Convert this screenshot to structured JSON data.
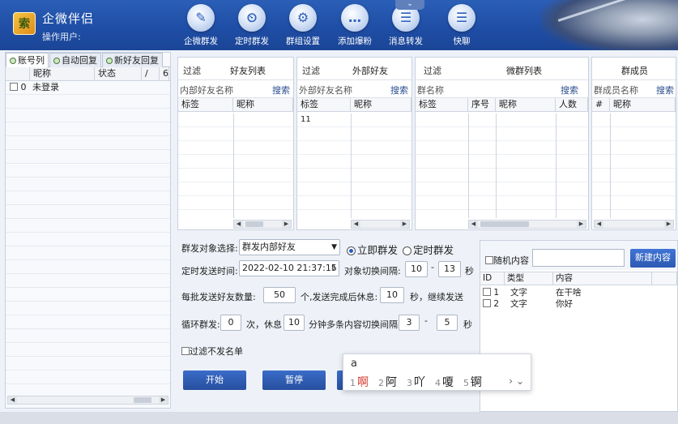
{
  "app": {
    "title": "企微伴侣",
    "operator_label": "操作用户:",
    "logo_char": "索"
  },
  "toolbar": [
    {
      "label": "企微群发",
      "glyph": "✎",
      "icon": "pen-icon"
    },
    {
      "label": "定时群发",
      "glyph": "⏲",
      "icon": "timer-icon"
    },
    {
      "label": "群组设置",
      "glyph": "⚙",
      "icon": "gear-icon"
    },
    {
      "label": "添加爆粉",
      "glyph": "…",
      "icon": "chat-bubble-icon"
    },
    {
      "label": "消息转发",
      "glyph": "☰",
      "icon": "message-forward-icon"
    },
    {
      "label": "快聊",
      "glyph": "☰",
      "icon": "quick-chat-icon"
    }
  ],
  "collapse_glyph": "⌄",
  "left": {
    "tabs": [
      "账号列",
      "自动回复",
      "新好友回复"
    ],
    "columns": [
      "昵称",
      "状态",
      "/",
      "6"
    ],
    "rows": [
      {
        "index": "0",
        "name": "未登录"
      }
    ]
  },
  "panels": {
    "friends": {
      "filter": "过滤",
      "title": "好友列表",
      "label": "内部好友名称",
      "search": "搜索",
      "columns": [
        "标签",
        "昵称"
      ]
    },
    "external": {
      "filter": "过滤",
      "title": "外部好友",
      "label": "外部好友名称",
      "search": "搜索",
      "columns": [
        "标签",
        "昵称"
      ],
      "rows": [
        [
          "11",
          ""
        ]
      ]
    },
    "groups": {
      "filter": "过滤",
      "title": "微群列表",
      "label": "群名称",
      "search": "搜索",
      "columns": [
        "标签",
        "序号",
        "昵称",
        "人数"
      ]
    },
    "members": {
      "title": "群成员",
      "label": "群成员名称",
      "search": "搜索",
      "columns": [
        "#",
        "昵称"
      ]
    }
  },
  "settings": {
    "target_label": "群发对象选择:",
    "target_value": "群发内部好友",
    "immediate_label": "立即群发",
    "scheduled_label": "定时群发",
    "mode_selected": "immediate",
    "time_label": "定时发送时间:",
    "time_value": "2022-02-10 21:37:15",
    "switch_interval_label": "对象切换间隔:",
    "switch_min": "10",
    "switch_max": "13",
    "dash": "-",
    "seconds": "秒",
    "batch_label": "每批发送好友数量:",
    "batch_value": "50",
    "batch_suffix": "个,发送完成后休息:",
    "rest_value": "10",
    "rest_suffix": "秒，继续发送",
    "loop_label": "循环群发:",
    "loop_value": "0",
    "loop_suffix": "次，休息",
    "loop_rest": "10",
    "minutes": "分钟",
    "content_interval_label": "多条内容切换间隔:",
    "content_min": "3",
    "content_max": "5",
    "filter_blacklist": "过滤不发名单",
    "start_button": "开始",
    "pause_button": "暂停"
  },
  "content": {
    "random_label": "随机内容",
    "new_button": "新建内容",
    "columns": [
      "ID",
      "类型",
      "内容"
    ],
    "rows": [
      {
        "id": "1",
        "type": "文字",
        "text": "在干啥"
      },
      {
        "id": "2",
        "type": "文字",
        "text": "你好"
      }
    ]
  },
  "ime": {
    "composition": "a",
    "candidates": [
      {
        "n": "1",
        "c": "啊"
      },
      {
        "n": "2",
        "c": "阿"
      },
      {
        "n": "3",
        "c": "吖"
      },
      {
        "n": "4",
        "c": "嗄"
      },
      {
        "n": "5",
        "c": "锕"
      }
    ],
    "next": "›",
    "expand": "⌄"
  },
  "colors": {
    "header": "#1f4ea6",
    "accent": "#2a5cc0",
    "highlight": "#d63c2f"
  }
}
